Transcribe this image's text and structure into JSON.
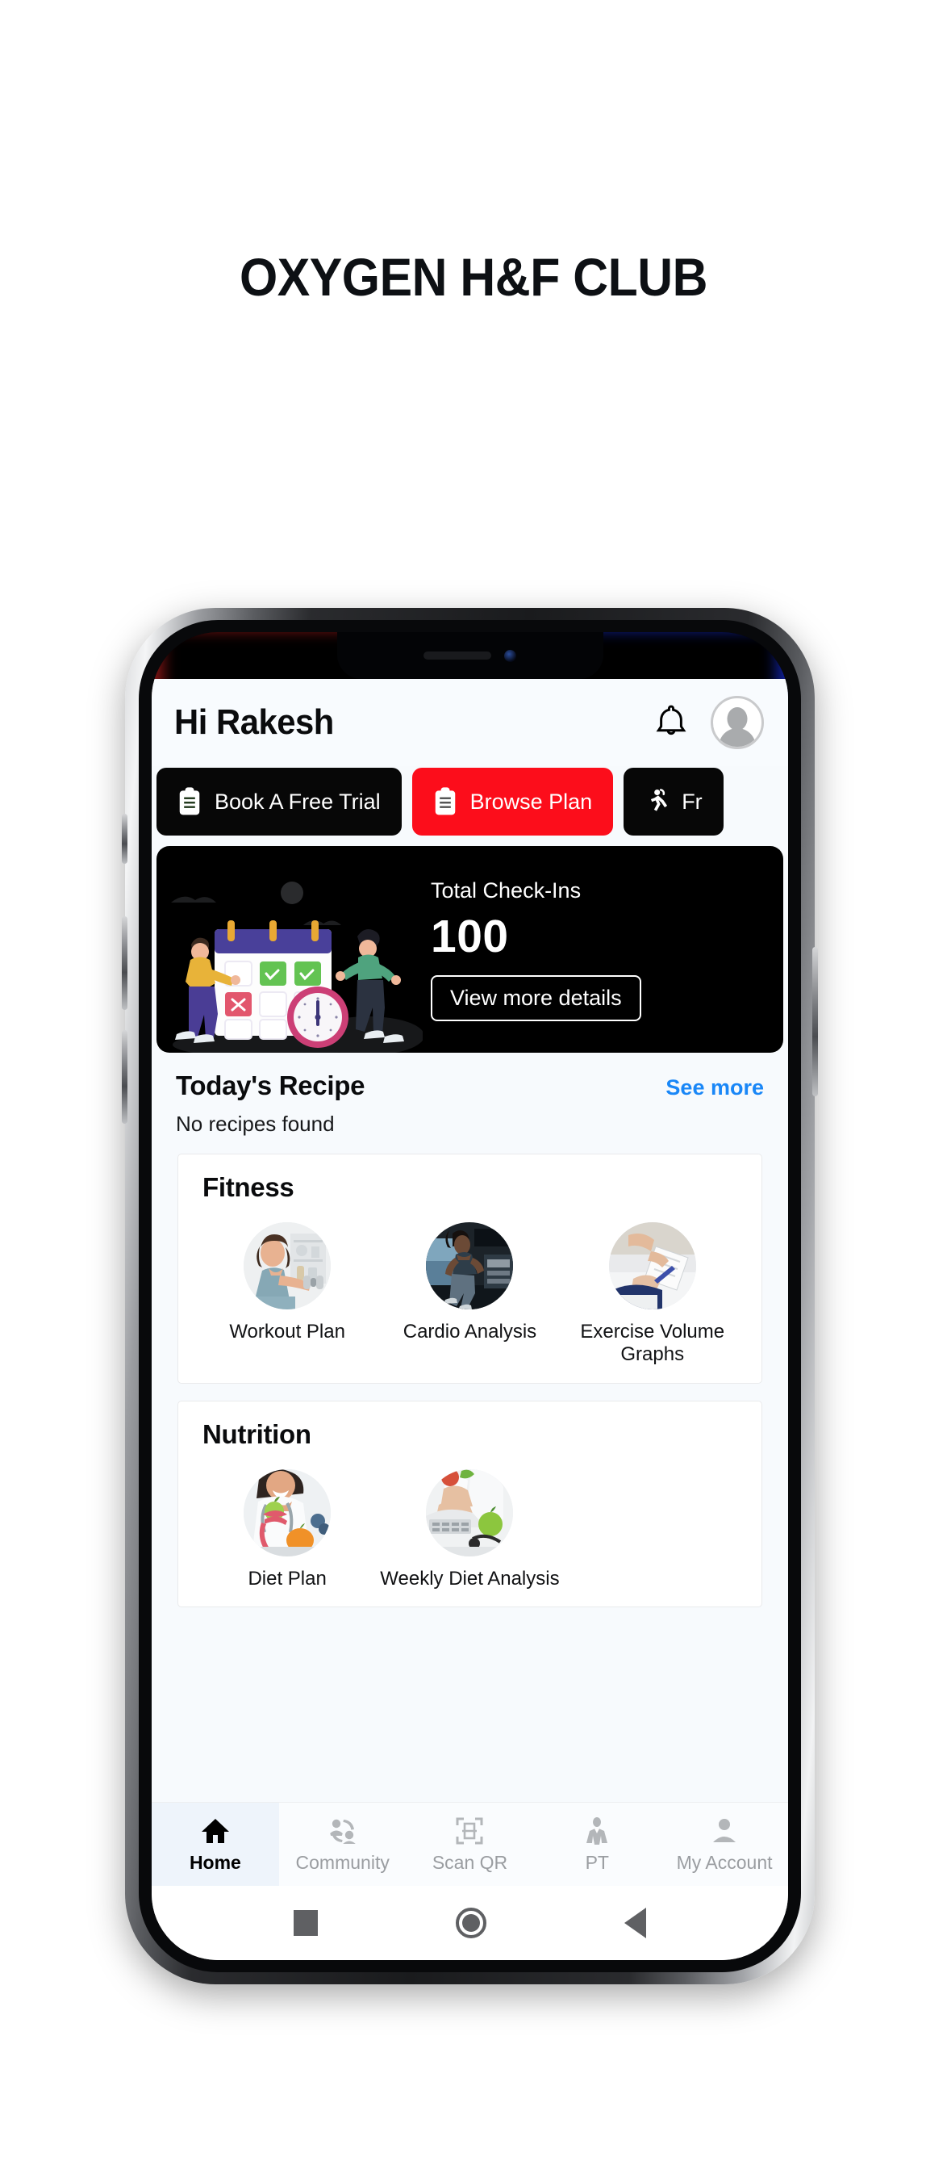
{
  "page": {
    "title": "OXYGEN H&F CLUB",
    "background": "#ffffff"
  },
  "colors": {
    "accent_red": "#fc0d1b",
    "link_blue": "#1a87f7",
    "dark": "#070707",
    "app_bg": "#f7fafd"
  },
  "app": {
    "header": {
      "greeting": "Hi Rakesh",
      "bell_icon": "bell-icon",
      "avatar_icon": "avatar-icon"
    },
    "quick_actions": [
      {
        "label": "Book A Free Trial",
        "icon": "clipboard-icon",
        "style": "dark"
      },
      {
        "label": "Browse Plan",
        "icon": "clipboard-icon",
        "style": "red"
      },
      {
        "label": "Fr",
        "icon": "running-person-icon",
        "style": "dark"
      }
    ],
    "checkins_card": {
      "label": "Total Check-Ins",
      "value": "100",
      "button_label": "View more details",
      "illustration": "calendar-checkin-illustration"
    },
    "recipe": {
      "title": "Today's Recipe",
      "see_more_label": "See more",
      "empty_text": "No recipes found"
    },
    "sections": [
      {
        "title": "Fitness",
        "tiles": [
          {
            "label": "Workout Plan",
            "image": "woman-dumbbell-photo"
          },
          {
            "label": "Cardio Analysis",
            "image": "woman-treadmill-photo"
          },
          {
            "label": "Exercise Volume Graphs",
            "image": "hand-writing-clipboard-photo"
          }
        ]
      },
      {
        "title": "Nutrition",
        "tiles": [
          {
            "label": "Diet Plan",
            "image": "nutritionist-fruit-photo"
          },
          {
            "label": "Weekly Diet Analysis",
            "image": "laptop-apple-photo"
          }
        ]
      }
    ],
    "tabbar": [
      {
        "label": "Home",
        "icon": "home-icon",
        "active": true
      },
      {
        "label": "Community",
        "icon": "community-icon",
        "active": false
      },
      {
        "label": "Scan QR",
        "icon": "scan-qr-icon",
        "active": false
      },
      {
        "label": "PT",
        "icon": "trainer-icon",
        "active": false
      },
      {
        "label": "My Account",
        "icon": "person-icon",
        "active": false
      }
    ],
    "system_nav": [
      {
        "icon": "recents-square-icon"
      },
      {
        "icon": "home-circle-icon"
      },
      {
        "icon": "back-triangle-icon"
      }
    ]
  }
}
